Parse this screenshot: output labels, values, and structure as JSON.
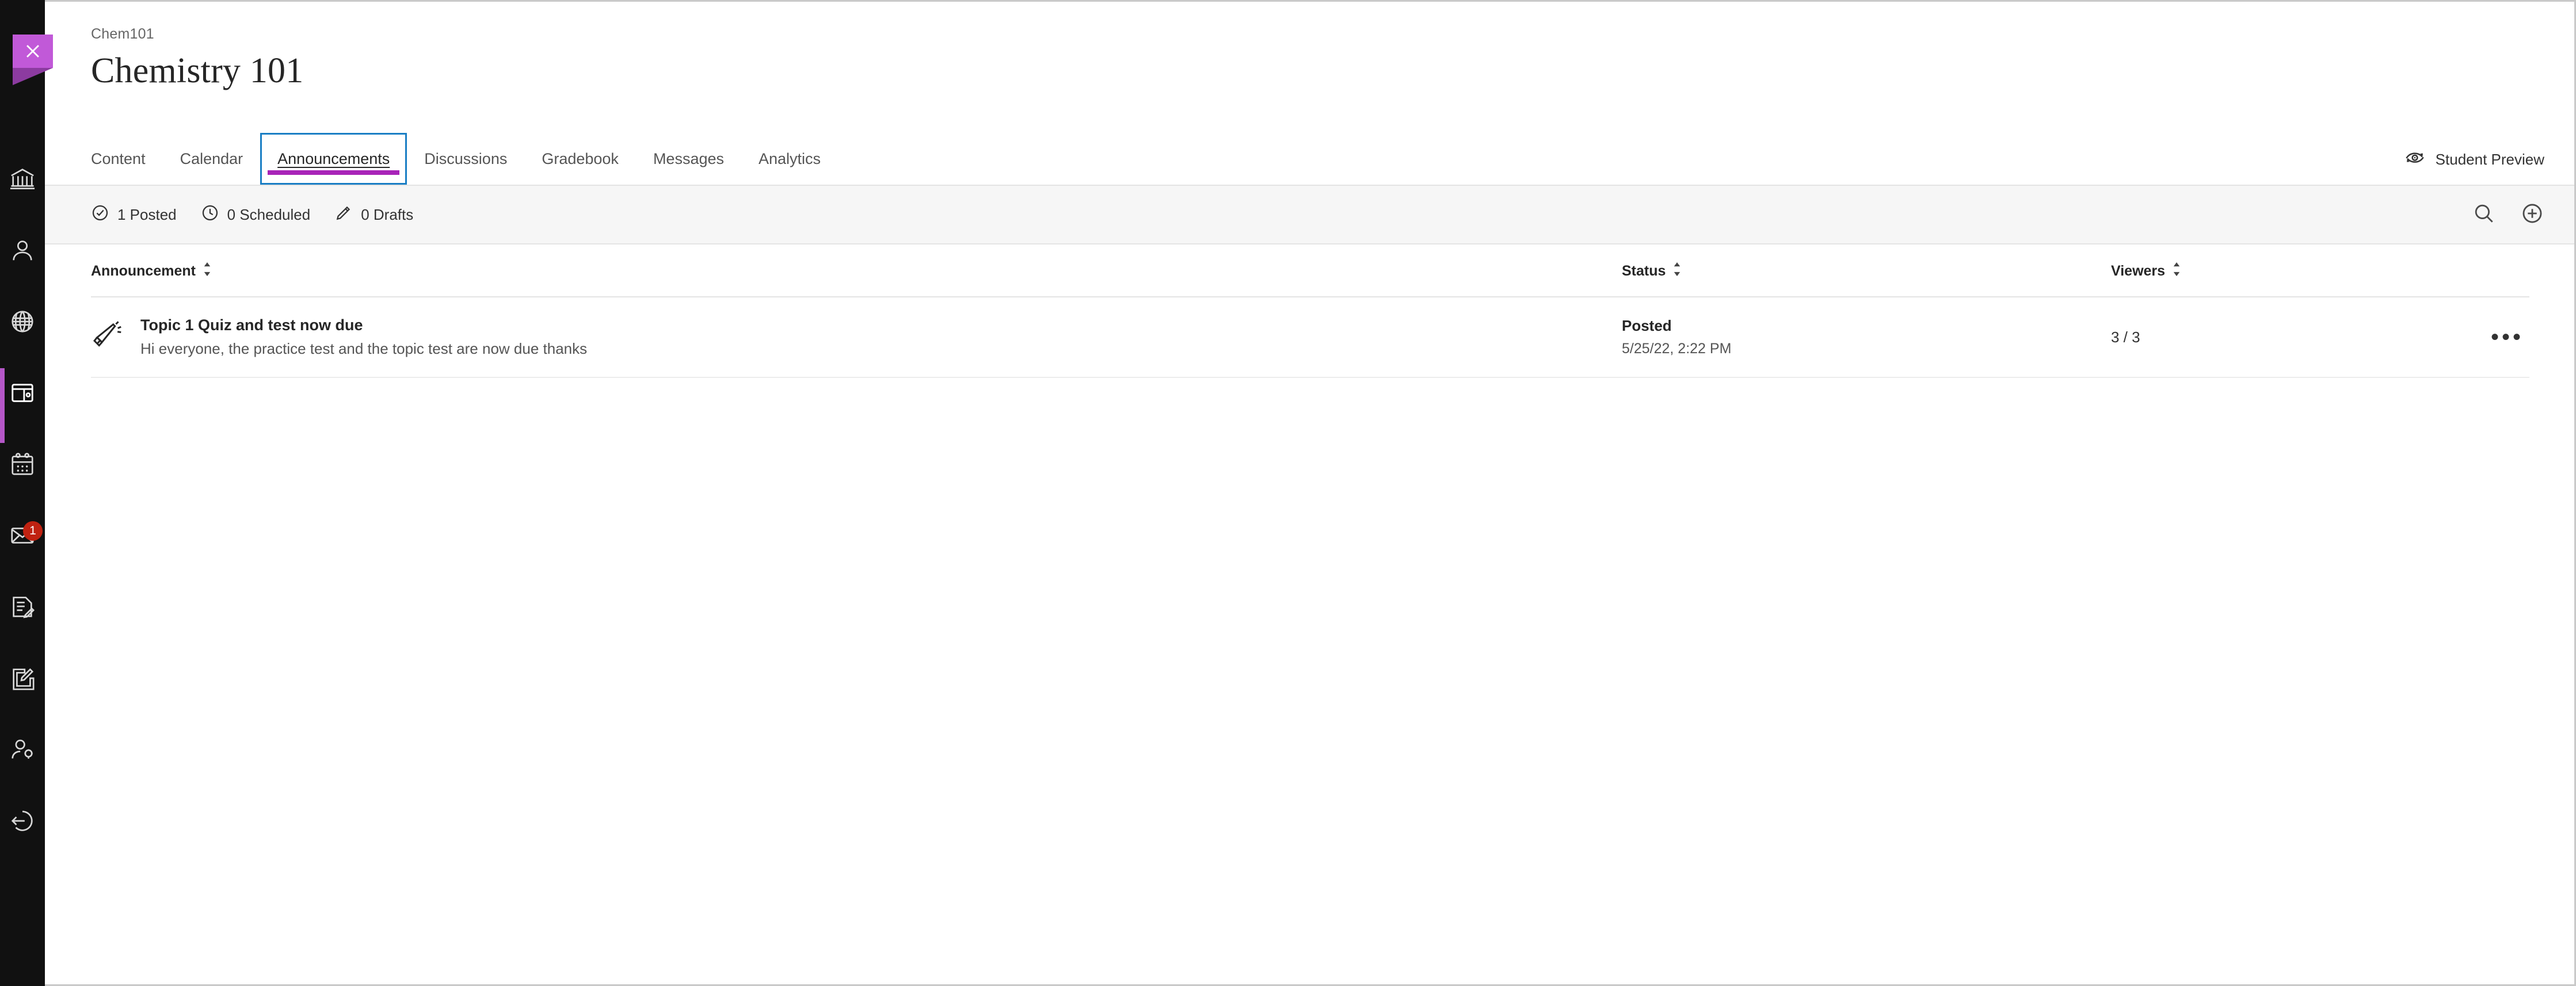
{
  "rail": {
    "items": [
      {
        "name": "institution-page",
        "icon": "institution-icon"
      },
      {
        "name": "profile",
        "icon": "person-icon"
      },
      {
        "name": "activity-stream",
        "icon": "globe-icon"
      },
      {
        "name": "courses",
        "icon": "courses-icon",
        "active": true
      },
      {
        "name": "calendar",
        "icon": "calendar-icon"
      },
      {
        "name": "messages",
        "icon": "envelope-icon",
        "badge": "1"
      },
      {
        "name": "grades",
        "icon": "grades-document-icon"
      },
      {
        "name": "tools",
        "icon": "edit-square-icon"
      },
      {
        "name": "admin",
        "icon": "person-gear-icon"
      },
      {
        "name": "sign-out",
        "icon": "sign-out-icon"
      }
    ]
  },
  "close_button": {
    "label": "Close",
    "icon": "close-x-icon",
    "color": "#c159d8"
  },
  "header": {
    "breadcrumb": "Chem101",
    "title": "Chemistry 101"
  },
  "tabs": {
    "items": [
      {
        "label": "Content",
        "active": false
      },
      {
        "label": "Calendar",
        "active": false
      },
      {
        "label": "Announcements",
        "active": true
      },
      {
        "label": "Discussions",
        "active": false
      },
      {
        "label": "Gradebook",
        "active": false
      },
      {
        "label": "Messages",
        "active": false
      },
      {
        "label": "Analytics",
        "active": false
      }
    ],
    "active_underline_color": "#a824b8",
    "focus_ring_color": "#1a7ec4"
  },
  "student_preview": {
    "label": "Student Preview",
    "icon": "student-preview-icon"
  },
  "statusbar": {
    "posted": "1 Posted",
    "scheduled": "0 Scheduled",
    "drafts": "0 Drafts",
    "search_label": "Search",
    "add_label": "Add announcement"
  },
  "table": {
    "columns": {
      "announcement": "Announcement",
      "status": "Status",
      "viewers": "Viewers"
    },
    "rows": [
      {
        "icon": "megaphone-icon",
        "title": "Topic 1 Quiz and test now due",
        "subtitle": "Hi everyone, the practice test and the topic test are now due thanks",
        "status": "Posted",
        "date": "5/25/22, 2:22 PM",
        "viewers": "3 / 3",
        "more_label": "•••"
      }
    ]
  }
}
